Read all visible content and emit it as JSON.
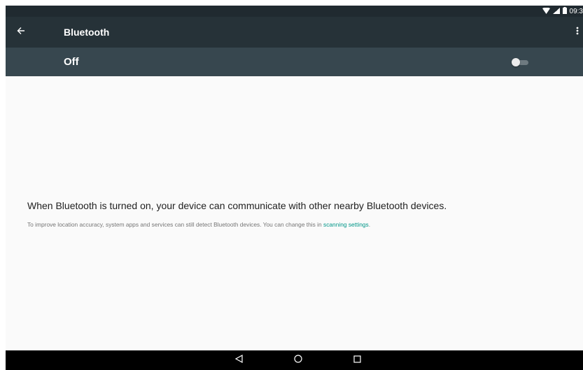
{
  "status_bar": {
    "time": "09:3",
    "icons": [
      "wifi-icon",
      "signal-icon",
      "battery-icon"
    ]
  },
  "toolbar": {
    "title": "Bluetooth",
    "back_icon": "arrow-back-icon",
    "menu_icon": "more-vert-icon"
  },
  "switch_bar": {
    "label": "Off",
    "checked": false
  },
  "content": {
    "message": "When Bluetooth is turned on, your device can communicate with other nearby Bluetooth devices.",
    "scanning_prefix": "To improve location accuracy, system apps and services can still detect Bluetooth devices. You can change this in ",
    "scanning_link": "scanning settings",
    "scanning_suffix": "."
  },
  "nav_bar": {
    "buttons": [
      "back-nav-icon",
      "home-nav-icon",
      "recents-nav-icon"
    ]
  },
  "colors": {
    "toolbar": "#263238",
    "switch_bar": "#37474f",
    "status_bar": "#202a30",
    "link": "#009688",
    "background": "#fafafa"
  }
}
